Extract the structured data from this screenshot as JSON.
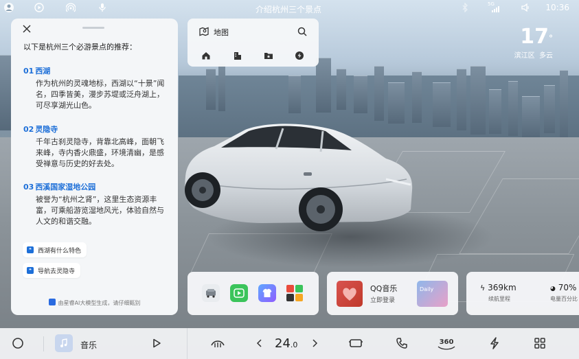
{
  "status_bar": {
    "title": "介绍杭州三个景点",
    "signal": "5G",
    "time": "10:36"
  },
  "weather": {
    "temperature": "17",
    "degree_symbol": "°",
    "location": "滨江区",
    "condition": "多云"
  },
  "ai_panel": {
    "intro": "以下是杭州三个必游景点的推荐：",
    "spots": [
      {
        "num": "01",
        "name": "西湖",
        "desc": "作为杭州的灵魂地标，西湖以“十景”闻名，四季皆美，漫步苏堤或泛舟湖上，可尽享湖光山色。"
      },
      {
        "num": "02",
        "name": "灵隐寺",
        "desc": "千年古刹灵隐寺，背靠北高峰，面朝飞来峰，寺内香火鼎盛，环境清幽，是感受禅意与历史的好去处。"
      },
      {
        "num": "03",
        "name": "西溪国家湿地公园",
        "desc": "被誉为“杭州之肾”，这里生态资源丰富，可乘船游览湿地风光，体验自然与人文的和谐交融。"
      }
    ],
    "suggestions": [
      "西湖有什么特色",
      "导航去灵隐寺"
    ],
    "footer": "由星睿AI大模型生成，请仔细甄别"
  },
  "map_card": {
    "title": "地图",
    "shortcuts": [
      "home-icon",
      "company-icon",
      "favorite-folder-icon",
      "charging-icon"
    ]
  },
  "music_card": {
    "app_name": "QQ音乐",
    "action": "立即登录",
    "playlist_label": "Daily"
  },
  "vehicle_card": {
    "range_value": "369km",
    "range_label": "续航里程",
    "battery_value": "70%",
    "battery_label": "电量百分比"
  },
  "dock": {
    "media_label": "音乐",
    "temperature": "24",
    "temperature_decimal": ".0",
    "view_360_label": "360"
  },
  "colors": {
    "accent": "#1d6fd8",
    "panel_bg": "#f4f6f8",
    "dock_bg": "#eef0f2"
  }
}
